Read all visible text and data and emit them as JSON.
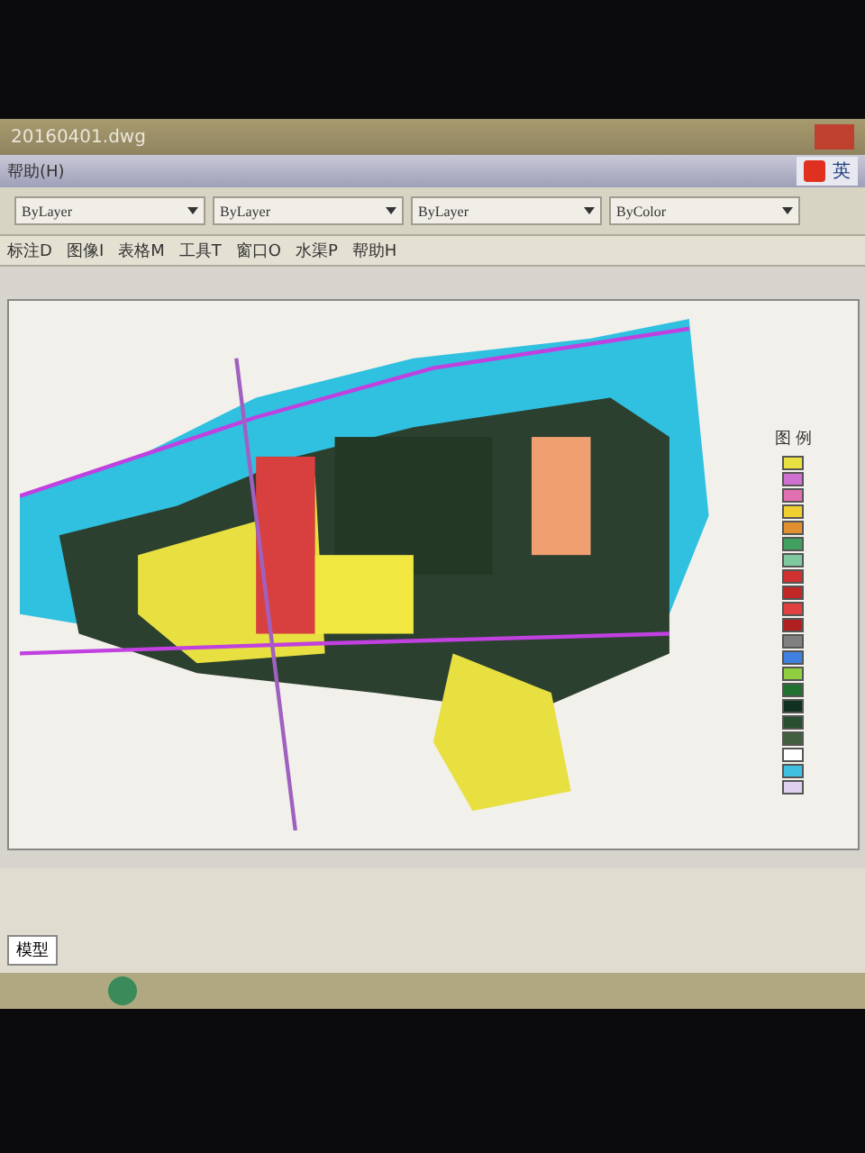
{
  "window": {
    "title": "20160401.dwg"
  },
  "menu_bar": {
    "items": [
      "帮助(H)"
    ]
  },
  "ime_bar": {
    "label": "英"
  },
  "toolbar": {
    "dropdowns": [
      "ByLayer",
      "ByLayer",
      "ByLayer",
      "ByColor"
    ]
  },
  "menu_row": {
    "items": [
      "标注D",
      "图像I",
      "表格M",
      "工具T",
      "窗口O",
      "水渠P",
      "帮助H"
    ]
  },
  "legend": {
    "title": "图 例",
    "items": [
      {
        "color": "#e8e040"
      },
      {
        "color": "#d070d0"
      },
      {
        "color": "#e070b0"
      },
      {
        "color": "#f0d030"
      },
      {
        "color": "#e09030"
      },
      {
        "color": "#40a060"
      },
      {
        "color": "#80c8a0"
      },
      {
        "color": "#d03030"
      },
      {
        "color": "#c02828"
      },
      {
        "color": "#e04040"
      },
      {
        "color": "#b02020"
      },
      {
        "color": "#808080"
      },
      {
        "color": "#4080e0"
      },
      {
        "color": "#90d040"
      },
      {
        "color": "#207030"
      },
      {
        "color": "#103020"
      },
      {
        "color": "#285030"
      },
      {
        "color": "#406040"
      },
      {
        "color": "#ffffff"
      },
      {
        "color": "#40c0e0"
      },
      {
        "color": "#e0d0f0"
      }
    ]
  },
  "layout_tabs": [
    {
      "label": "模型",
      "selected": true
    }
  ]
}
